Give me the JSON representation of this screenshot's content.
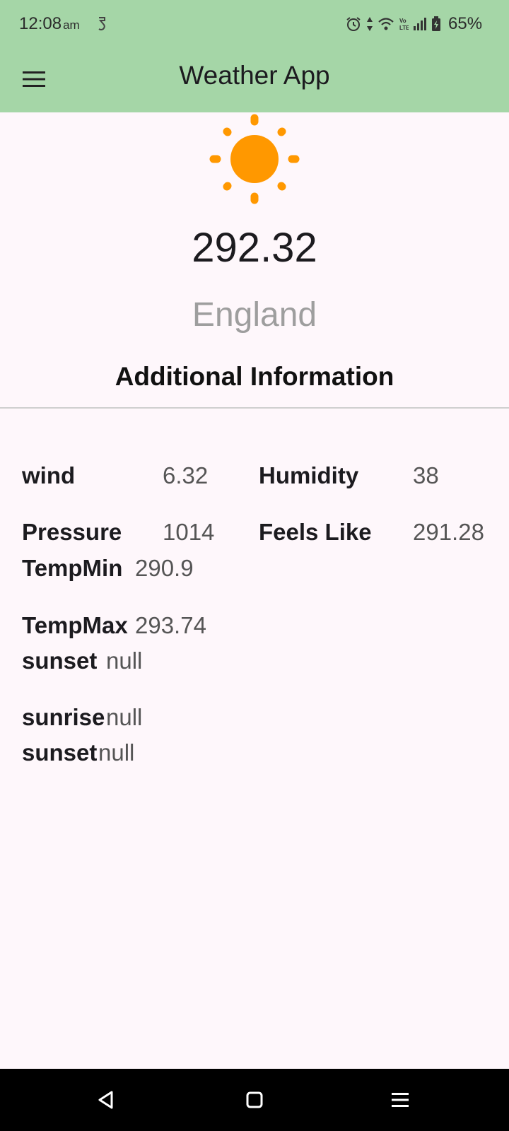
{
  "status_bar": {
    "time": "12:08",
    "ampm": "am",
    "battery": "65%"
  },
  "app_bar": {
    "title": "Weather App",
    "menu_icon": "menu-icon"
  },
  "weather": {
    "icon": "sun-icon",
    "temperature": "292.32",
    "city": "England"
  },
  "additional": {
    "title": "Additional Information",
    "wind_label": "wind",
    "wind_value": "6.32",
    "humidity_label": "Humidity",
    "humidity_value": "38",
    "pressure_label": "Pressure",
    "pressure_value": "1014",
    "feels_like_label": "Feels Like",
    "feels_like_value": "291.28",
    "temp_min_label": "TempMin",
    "temp_min_value": "290.9",
    "temp_max_label": "TempMax",
    "temp_max_value": "293.74",
    "sunset_label_1": "sunset",
    "sunset_value_1": "null",
    "sunrise_label": "sunrise",
    "sunrise_value": "null",
    "sunset_label_2": "sunset",
    "sunset_value_2": "null"
  },
  "colors": {
    "app_bar": "#A5D6A7",
    "background": "#FEF7FB",
    "sun": "#FF9800",
    "city_text": "#9E9E9E"
  },
  "nav_bar": {
    "icons": [
      "back-icon",
      "home-icon",
      "recents-icon"
    ]
  }
}
